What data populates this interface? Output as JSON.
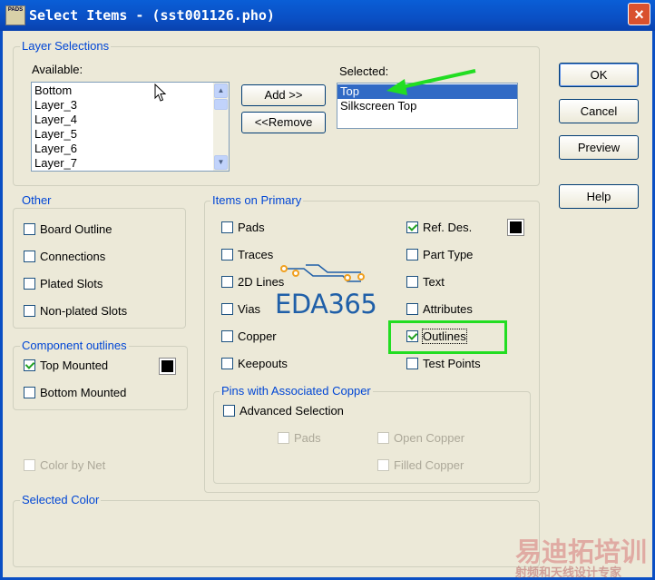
{
  "window": {
    "title": "Select Items - (sst001126.pho)",
    "app_icon_text": "PADS",
    "close_glyph": "×"
  },
  "layer_selections": {
    "group_label": "Layer Selections",
    "available_label": "Available:",
    "available_items": [
      "Bottom",
      "Layer_3",
      "Layer_4",
      "Layer_5",
      "Layer_6",
      "Layer_7"
    ],
    "selected_label": "Selected:",
    "selected_items": [
      "Top",
      "Silkscreen Top"
    ],
    "add_label": "Add >>",
    "remove_label": "<<Remove"
  },
  "dialog_buttons": {
    "ok": "OK",
    "cancel": "Cancel",
    "preview": "Preview",
    "help": "Help"
  },
  "other": {
    "group_label": "Other",
    "items": [
      {
        "label": "Board Outline",
        "checked": false
      },
      {
        "label": "Connections",
        "checked": false
      },
      {
        "label": "Plated Slots",
        "checked": false
      },
      {
        "label": "Non-plated Slots",
        "checked": false
      }
    ]
  },
  "component_outlines": {
    "group_label": "Component outlines",
    "items": [
      {
        "label": "Top Mounted",
        "checked": true
      },
      {
        "label": "Bottom Mounted",
        "checked": false
      }
    ]
  },
  "color_by_net": {
    "label": "Color by Net",
    "checked": false,
    "enabled": false
  },
  "items_on_primary": {
    "group_label": "Items on Primary",
    "left": [
      {
        "label": "Pads",
        "checked": false
      },
      {
        "label": "Traces",
        "checked": false
      },
      {
        "label": "2D Lines",
        "checked": false
      },
      {
        "label": "Vias",
        "checked": false
      },
      {
        "label": "Copper",
        "checked": false
      },
      {
        "label": "Keepouts",
        "checked": false
      }
    ],
    "right": [
      {
        "label": "Ref. Des.",
        "checked": true
      },
      {
        "label": "Part Type",
        "checked": false
      },
      {
        "label": "Text",
        "checked": false
      },
      {
        "label": "Attributes",
        "checked": false
      },
      {
        "label": "Outlines",
        "checked": true
      },
      {
        "label": "Test Points",
        "checked": false
      }
    ]
  },
  "pins_copper": {
    "group_label": "Pins with Associated Copper",
    "advanced_label": "Advanced Selection",
    "pads_label": "Pads",
    "open_copper_label": "Open Copper",
    "filled_copper_label": "Filled Copper"
  },
  "selected_color": {
    "group_label": "Selected Color"
  },
  "overlay": {
    "logo_text": "EDA365",
    "watermark_main": "易迪拓培训",
    "watermark_sub": "射频和天线设计专家",
    "highlight_color": "#22dd22",
    "arrow_color": "#22dd22"
  },
  "colors": {
    "titlebar": "#0a4fc4",
    "group_label": "#0046d5",
    "selection": "#316ac5"
  }
}
